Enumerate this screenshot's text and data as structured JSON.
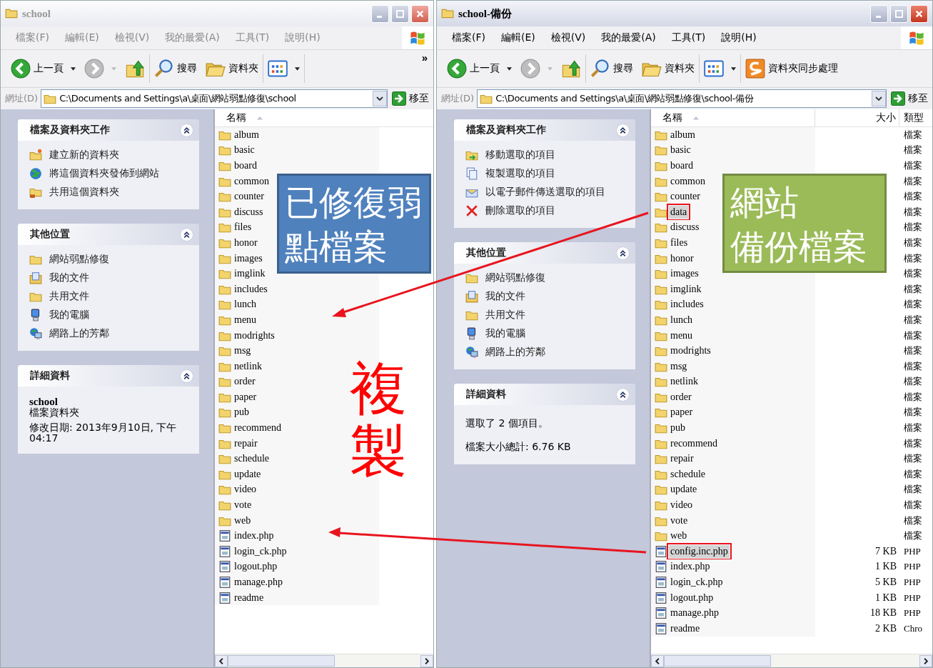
{
  "windows": [
    {
      "title": "school",
      "active": false,
      "menu": [
        "檔案(F)",
        "編輯(E)",
        "檢視(V)",
        "我的最愛(A)",
        "工具(T)",
        "說明(H)"
      ],
      "toolbar": [
        {
          "kind": "back",
          "label": "上一頁"
        },
        {
          "kind": "forward"
        },
        {
          "kind": "up"
        },
        {
          "kind": "search",
          "label": "搜尋"
        },
        {
          "kind": "folders",
          "label": "資料夾"
        },
        {
          "kind": "views"
        },
        {
          "kind": "more",
          "label": "»"
        }
      ],
      "address": {
        "label": "網址(D)",
        "value": "C:\\Documents and Settings\\a\\桌面\\網站弱點修復\\school",
        "go": "移至"
      },
      "panels": [
        {
          "title": "檔案及資料夾工作",
          "items": [
            {
              "kind": "new-folder",
              "label": "建立新的資料夾"
            },
            {
              "kind": "globe",
              "label": "將這個資料夾發佈到網站"
            },
            {
              "kind": "share",
              "label": "共用這個資料夾"
            }
          ]
        },
        {
          "title": "其他位置",
          "items": [
            {
              "kind": "folder",
              "label": "網站弱點修復"
            },
            {
              "kind": "documents",
              "label": "我的文件"
            },
            {
              "kind": "folder",
              "label": "共用文件"
            },
            {
              "kind": "computer",
              "label": "我的電腦"
            },
            {
              "kind": "network",
              "label": "網路上的芳鄰"
            }
          ]
        },
        {
          "title": "詳細資料",
          "lines": [
            {
              "kind": "name",
              "text": "school"
            },
            {
              "kind": "type",
              "text": "檔案資料夾"
            },
            {
              "kind": "text",
              "text": "修改日期: 2013年9月10日, 下午 04:17"
            }
          ]
        }
      ],
      "columns": [
        {
          "label": "名稱",
          "sorted": true
        }
      ],
      "files": [
        {
          "name": "album",
          "kind": "folder",
          "selected": false
        },
        {
          "name": "basic",
          "kind": "folder",
          "selected": false
        },
        {
          "name": "board",
          "kind": "folder",
          "selected": false
        },
        {
          "name": "common",
          "kind": "folder",
          "selected": false
        },
        {
          "name": "counter",
          "kind": "folder",
          "selected": false
        },
        {
          "name": "discuss",
          "kind": "folder",
          "selected": false
        },
        {
          "name": "files",
          "kind": "folder",
          "selected": false
        },
        {
          "name": "honor",
          "kind": "folder",
          "selected": false
        },
        {
          "name": "images",
          "kind": "folder",
          "selected": false
        },
        {
          "name": "imglink",
          "kind": "folder",
          "selected": false
        },
        {
          "name": "includes",
          "kind": "folder",
          "selected": false
        },
        {
          "name": "lunch",
          "kind": "folder",
          "selected": false
        },
        {
          "name": "menu",
          "kind": "folder",
          "selected": false
        },
        {
          "name": "modrights",
          "kind": "folder",
          "selected": false
        },
        {
          "name": "msg",
          "kind": "folder",
          "selected": false
        },
        {
          "name": "netlink",
          "kind": "folder",
          "selected": false
        },
        {
          "name": "order",
          "kind": "folder",
          "selected": false
        },
        {
          "name": "paper",
          "kind": "folder",
          "selected": false
        },
        {
          "name": "pub",
          "kind": "folder",
          "selected": false
        },
        {
          "name": "recommend",
          "kind": "folder",
          "selected": false
        },
        {
          "name": "repair",
          "kind": "folder",
          "selected": false
        },
        {
          "name": "schedule",
          "kind": "folder",
          "selected": false
        },
        {
          "name": "update",
          "kind": "folder",
          "selected": false
        },
        {
          "name": "video",
          "kind": "folder",
          "selected": false
        },
        {
          "name": "vote",
          "kind": "folder",
          "selected": false
        },
        {
          "name": "web",
          "kind": "folder",
          "selected": false
        },
        {
          "name": "index.php",
          "kind": "file",
          "selected": false
        },
        {
          "name": "login_ck.php",
          "kind": "file",
          "selected": false
        },
        {
          "name": "logout.php",
          "kind": "file",
          "selected": false
        },
        {
          "name": "manage.php",
          "kind": "file",
          "selected": false
        },
        {
          "name": "readme",
          "kind": "file",
          "selected": false
        }
      ]
    },
    {
      "title": "school-備份",
      "active": true,
      "menu": [
        "檔案(F)",
        "編輯(E)",
        "檢視(V)",
        "我的最愛(A)",
        "工具(T)",
        "說明(H)"
      ],
      "toolbar": [
        {
          "kind": "back",
          "label": "上一頁"
        },
        {
          "kind": "forward"
        },
        {
          "kind": "up"
        },
        {
          "kind": "search",
          "label": "搜尋"
        },
        {
          "kind": "folders",
          "label": "資料夾"
        },
        {
          "kind": "views"
        },
        {
          "kind": "sync",
          "label": "資料夾同步處理"
        }
      ],
      "address": {
        "label": "網址(D)",
        "value": "C:\\Documents and Settings\\a\\桌面\\網站弱點修復\\school-備份",
        "go": "移至"
      },
      "panels": [
        {
          "title": "檔案及資料夾工作",
          "items": [
            {
              "kind": "move",
              "label": "移動選取的項目"
            },
            {
              "kind": "copy",
              "label": "複製選取的項目"
            },
            {
              "kind": "mail",
              "label": "以電子郵件傳送選取的項目"
            },
            {
              "kind": "delete",
              "label": "刪除選取的項目"
            }
          ]
        },
        {
          "title": "其他位置",
          "items": [
            {
              "kind": "folder",
              "label": "網站弱點修復"
            },
            {
              "kind": "documents",
              "label": "我的文件"
            },
            {
              "kind": "folder",
              "label": "共用文件"
            },
            {
              "kind": "computer",
              "label": "我的電腦"
            },
            {
              "kind": "network",
              "label": "網路上的芳鄰"
            }
          ]
        },
        {
          "title": "詳細資料",
          "lines": [
            {
              "kind": "text",
              "text": "選取了 2 個項目。"
            },
            {
              "kind": "text",
              "text": "檔案大小總計: 6.76 KB"
            }
          ]
        }
      ],
      "columns": [
        {
          "label": "名稱",
          "sorted": true
        },
        {
          "label": "大小",
          "sorted": false
        },
        {
          "label": "類型",
          "sorted": false
        }
      ],
      "files": [
        {
          "name": "album",
          "kind": "folder",
          "type": "檔案",
          "selected": false
        },
        {
          "name": "basic",
          "kind": "folder",
          "type": "檔案",
          "selected": false
        },
        {
          "name": "board",
          "kind": "folder",
          "type": "檔案",
          "selected": false
        },
        {
          "name": "common",
          "kind": "folder",
          "type": "檔案",
          "selected": false
        },
        {
          "name": "counter",
          "kind": "folder",
          "type": "檔案",
          "selected": false
        },
        {
          "name": "data",
          "kind": "folder",
          "type": "檔案",
          "selected": true
        },
        {
          "name": "discuss",
          "kind": "folder",
          "type": "檔案",
          "selected": false
        },
        {
          "name": "files",
          "kind": "folder",
          "type": "檔案",
          "selected": false
        },
        {
          "name": "honor",
          "kind": "folder",
          "type": "檔案",
          "selected": false
        },
        {
          "name": "images",
          "kind": "folder",
          "type": "檔案",
          "selected": false
        },
        {
          "name": "imglink",
          "kind": "folder",
          "type": "檔案",
          "selected": false
        },
        {
          "name": "includes",
          "kind": "folder",
          "type": "檔案",
          "selected": false
        },
        {
          "name": "lunch",
          "kind": "folder",
          "type": "檔案",
          "selected": false
        },
        {
          "name": "menu",
          "kind": "folder",
          "type": "檔案",
          "selected": false
        },
        {
          "name": "modrights",
          "kind": "folder",
          "type": "檔案",
          "selected": false
        },
        {
          "name": "msg",
          "kind": "folder",
          "type": "檔案",
          "selected": false
        },
        {
          "name": "netlink",
          "kind": "folder",
          "type": "檔案",
          "selected": false
        },
        {
          "name": "order",
          "kind": "folder",
          "type": "檔案",
          "selected": false
        },
        {
          "name": "paper",
          "kind": "folder",
          "type": "檔案",
          "selected": false
        },
        {
          "name": "pub",
          "kind": "folder",
          "type": "檔案",
          "selected": false
        },
        {
          "name": "recommend",
          "kind": "folder",
          "type": "檔案",
          "selected": false
        },
        {
          "name": "repair",
          "kind": "folder",
          "type": "檔案",
          "selected": false
        },
        {
          "name": "schedule",
          "kind": "folder",
          "type": "檔案",
          "selected": false
        },
        {
          "name": "update",
          "kind": "folder",
          "type": "檔案",
          "selected": false
        },
        {
          "name": "video",
          "kind": "folder",
          "type": "檔案",
          "selected": false
        },
        {
          "name": "vote",
          "kind": "folder",
          "type": "檔案",
          "selected": false
        },
        {
          "name": "web",
          "kind": "folder",
          "type": "檔案",
          "selected": false
        },
        {
          "name": "config.inc.php",
          "kind": "file",
          "size": "7 KB",
          "type": "PHP",
          "selected": true
        },
        {
          "name": "index.php",
          "kind": "file",
          "size": "1 KB",
          "type": "PHP",
          "selected": false
        },
        {
          "name": "login_ck.php",
          "kind": "file",
          "size": "5 KB",
          "type": "PHP",
          "selected": false
        },
        {
          "name": "logout.php",
          "kind": "file",
          "size": "1 KB",
          "type": "PHP",
          "selected": false
        },
        {
          "name": "manage.php",
          "kind": "file",
          "size": "18 KB",
          "type": "PHP",
          "selected": false
        },
        {
          "name": "readme",
          "kind": "file",
          "size": "2 KB",
          "type": "Chro",
          "selected": false
        }
      ]
    }
  ],
  "annotations": [
    {
      "kind": "box",
      "lines": [
        "已修復弱",
        "點檔案"
      ],
      "color": "#4f81bd"
    },
    {
      "kind": "box",
      "lines": [
        "網站",
        "備份檔案"
      ],
      "color": "#9bbb59"
    },
    {
      "kind": "vertical",
      "lines": [
        "複製"
      ],
      "color": "#ff0000"
    }
  ]
}
